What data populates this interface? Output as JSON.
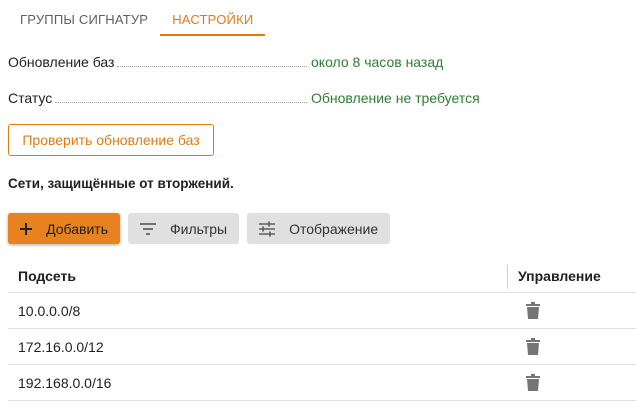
{
  "tabs": [
    {
      "label": "ГРУППЫ СИГНАТУР",
      "active": false
    },
    {
      "label": "НАСТРОЙКИ",
      "active": true
    }
  ],
  "status_rows": [
    {
      "label": "Обновление баз",
      "value": "около 8 часов назад"
    },
    {
      "label": "Статус",
      "value": "Обновление не требуется"
    }
  ],
  "check_update_button": "Проверить обновление баз",
  "section_title": "Сети, защищённые от вторжений.",
  "toolbar": {
    "add_label": "Добавить",
    "filters_label": "Фильтры",
    "display_label": "Отображение"
  },
  "table": {
    "columns": [
      "Подсеть",
      "Управление"
    ],
    "rows": [
      {
        "subnet": "10.0.0.0/8"
      },
      {
        "subnet": "172.16.0.0/12"
      },
      {
        "subnet": "192.168.0.0/16"
      }
    ]
  },
  "colors": {
    "accent": "#e07b14",
    "status_value": "#2e7d32",
    "primary_button": "#e8821e",
    "secondary_button": "#e0e0e0"
  }
}
